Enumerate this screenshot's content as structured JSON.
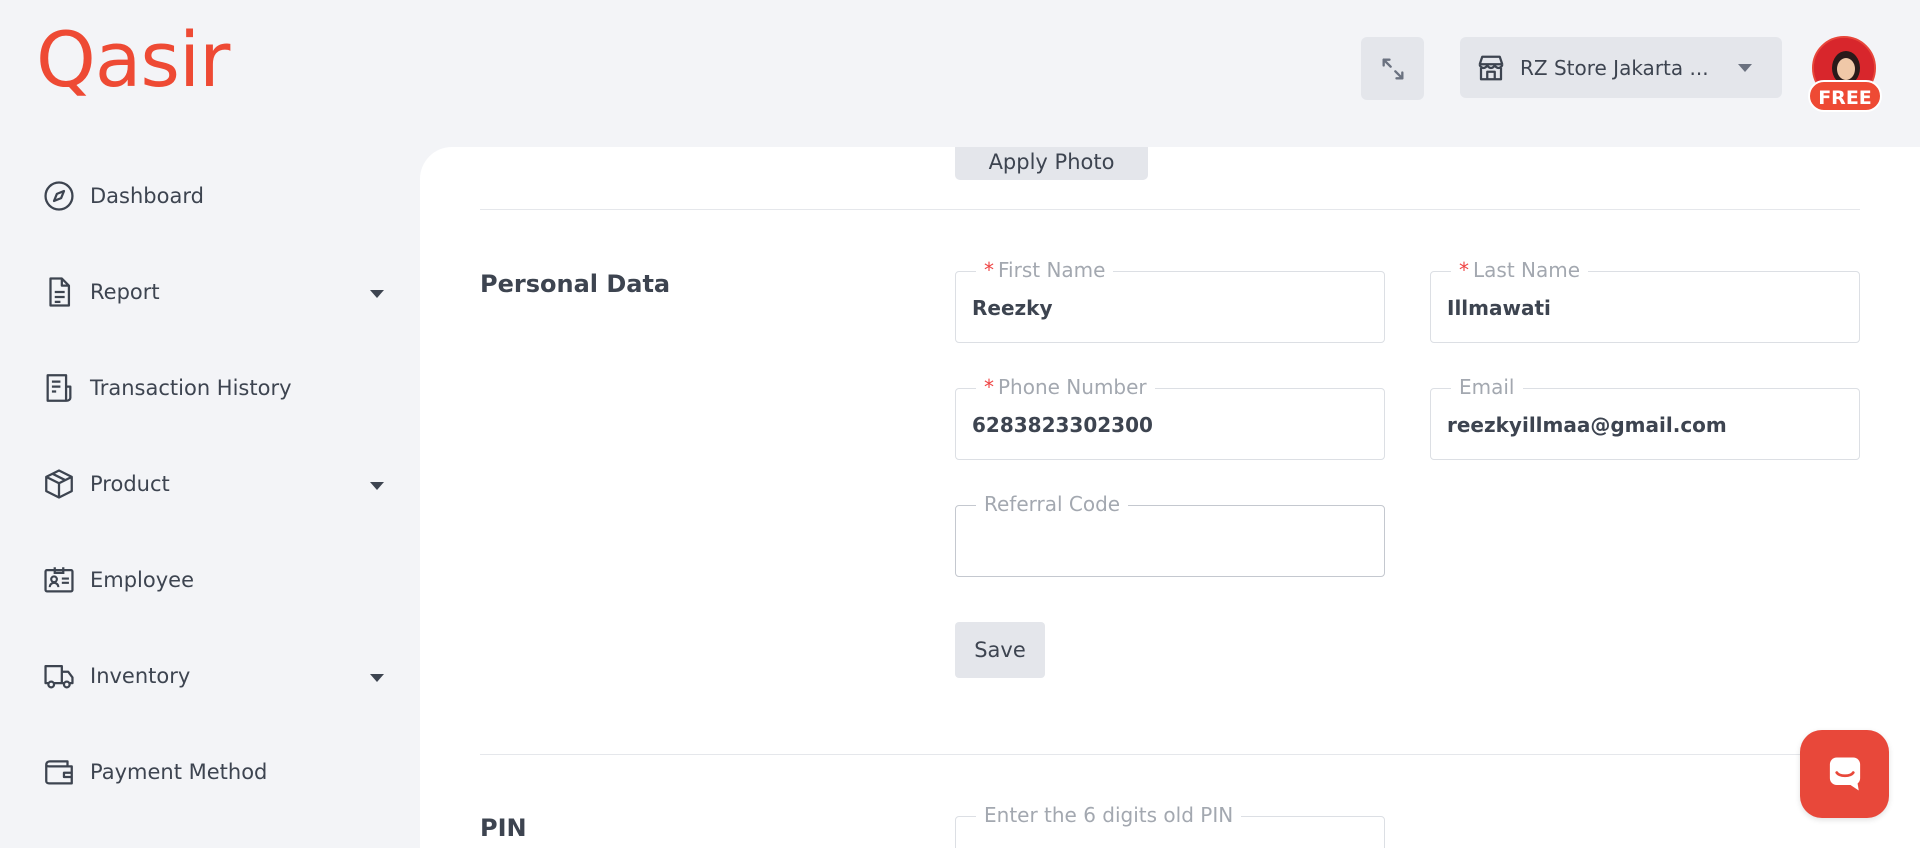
{
  "brand": {
    "logo_text": "Qasir",
    "color": "#ee4a34"
  },
  "header": {
    "store_name": "RZ Store Jakarta ...",
    "plan_badge": "FREE"
  },
  "sidebar": {
    "items": [
      {
        "label": "Dashboard",
        "icon": "compass-icon",
        "has_submenu": false
      },
      {
        "label": "Report",
        "icon": "document-icon",
        "has_submenu": true
      },
      {
        "label": "Transaction History",
        "icon": "receipt-icon",
        "has_submenu": false
      },
      {
        "label": "Product",
        "icon": "box-icon",
        "has_submenu": true
      },
      {
        "label": "Employee",
        "icon": "id-card-icon",
        "has_submenu": false
      },
      {
        "label": "Inventory",
        "icon": "truck-icon",
        "has_submenu": true
      },
      {
        "label": "Payment Method",
        "icon": "wallet-icon",
        "has_submenu": false
      }
    ]
  },
  "main": {
    "apply_photo_label": "Apply Photo",
    "personal_data": {
      "title": "Personal Data",
      "first_name": {
        "label": "First Name",
        "required": true,
        "value": "Reezky"
      },
      "last_name": {
        "label": "Last Name",
        "required": true,
        "value": "Illmawati"
      },
      "phone_number": {
        "label": "Phone Number",
        "required": true,
        "value": "6283823302300"
      },
      "email": {
        "label": "Email",
        "required": false,
        "value": "reezkyillmaa@gmail.com"
      },
      "referral_code": {
        "label": "Referral Code",
        "required": false,
        "value": ""
      },
      "save_label": "Save"
    },
    "pin": {
      "title": "PIN",
      "old_pin": {
        "placeholder": "Enter the 6 digits old PIN",
        "value": ""
      }
    }
  }
}
